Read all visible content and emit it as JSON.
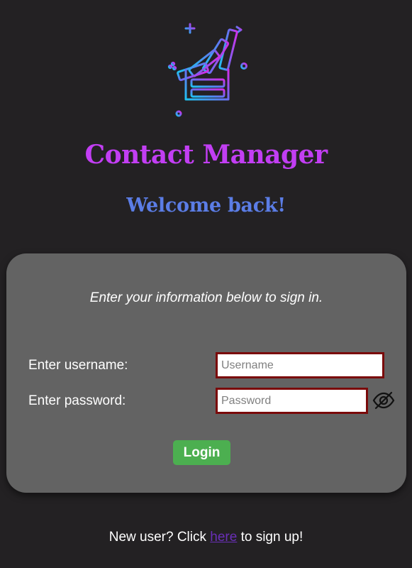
{
  "header": {
    "logo_icon": "stacked-books-logo-icon",
    "title": "Contact Manager",
    "welcome": "Welcome back!"
  },
  "colors": {
    "title": "#c23ef3",
    "welcome": "#5b7de6",
    "card": "#636363",
    "input_border": "#7a0a0a",
    "login_button": "#4caf50",
    "link": "#6a2fb8",
    "background": "#232123"
  },
  "form": {
    "instructions": "Enter your information below to sign in.",
    "username_label": "Enter username:",
    "username_placeholder": "Username",
    "username_value": "",
    "password_label": "Enter password:",
    "password_placeholder": "Password",
    "password_value": "",
    "password_toggle_icon": "eye-slash-icon",
    "login_label": "Login"
  },
  "footer": {
    "prefix": "New user? Click ",
    "link_text": "here",
    "suffix": " to sign up!"
  }
}
